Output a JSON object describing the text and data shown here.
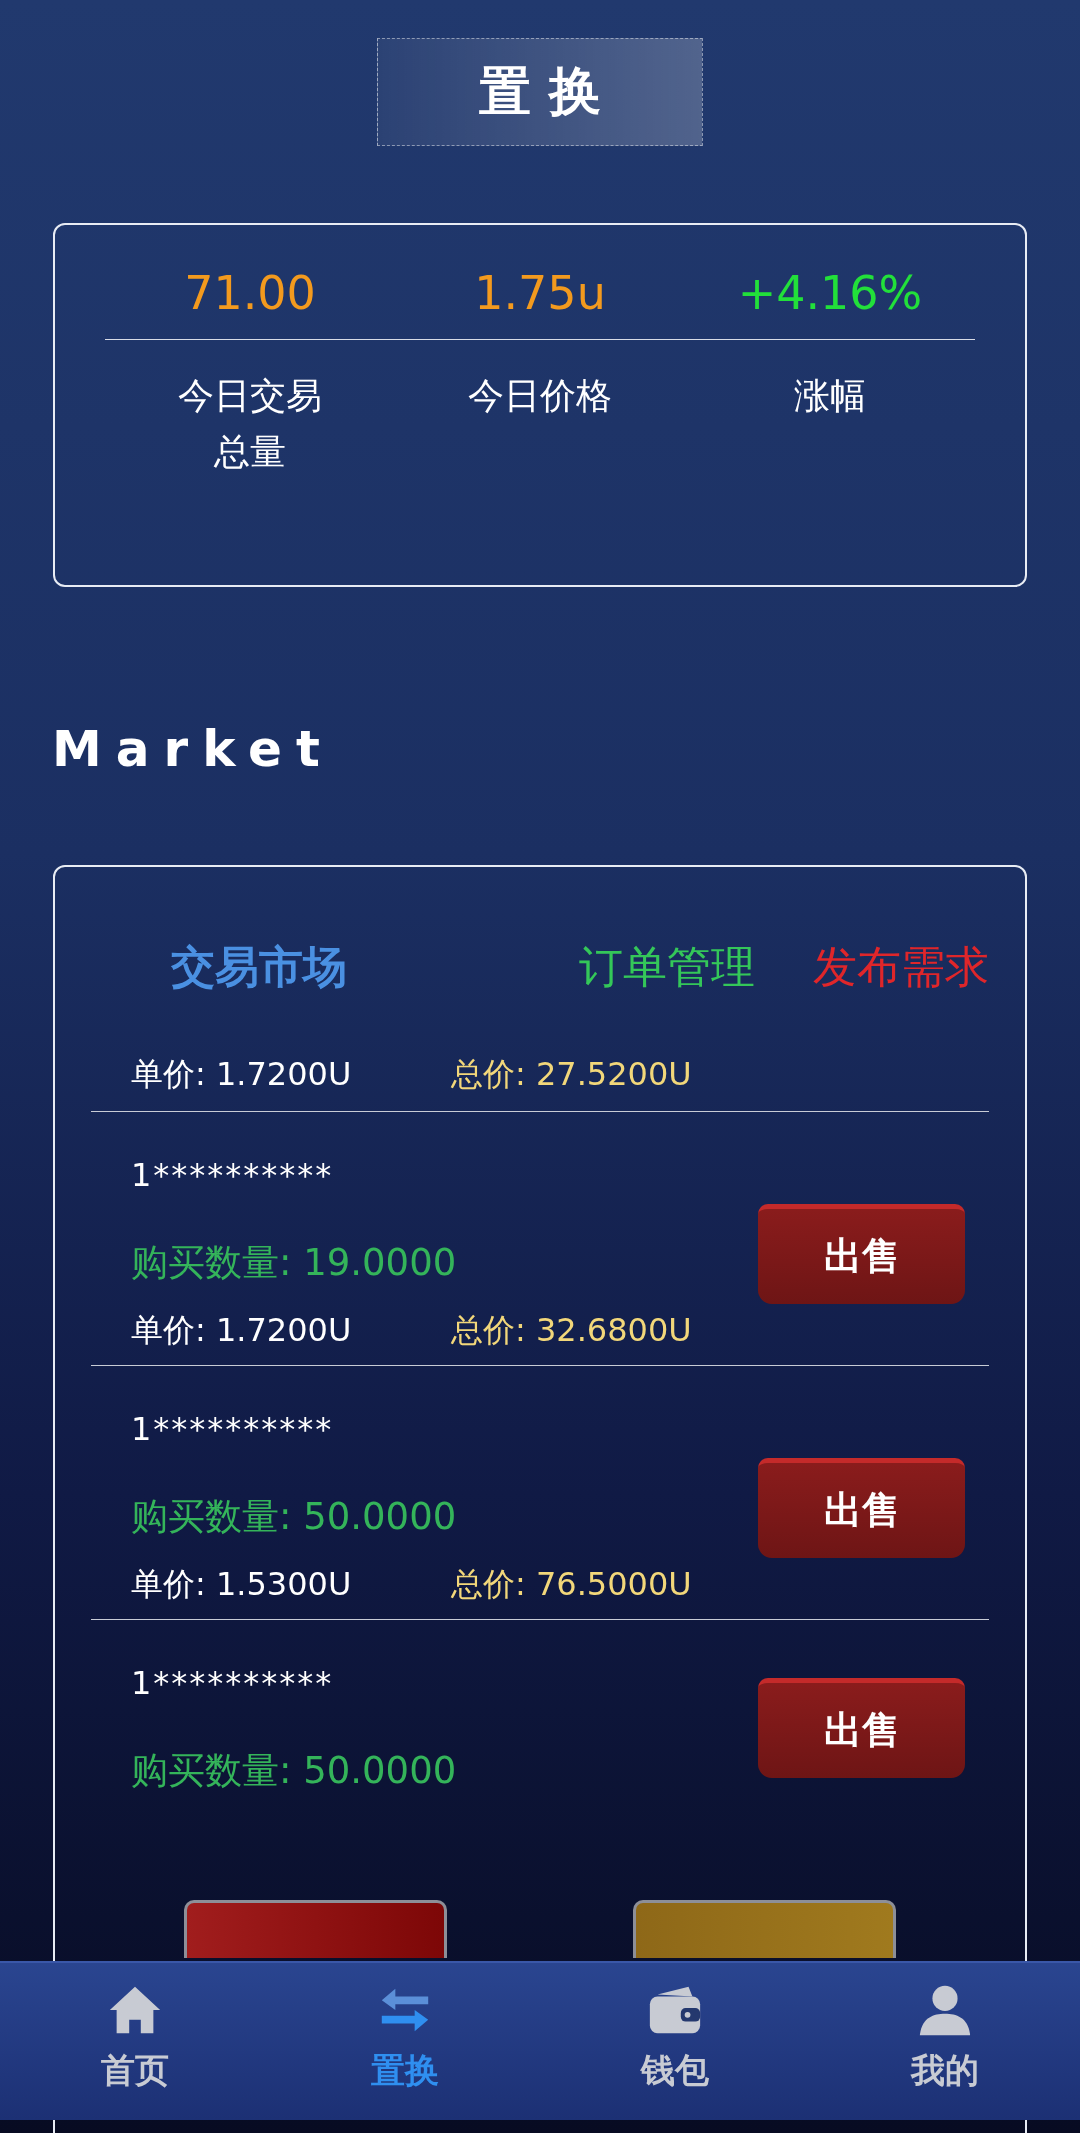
{
  "header": {
    "title": "置 换"
  },
  "stats": [
    {
      "value": "71.00",
      "label": "今日交易总量",
      "color": "#f39a1e"
    },
    {
      "value": "1.75u",
      "label": "今日价格",
      "color": "#f39a1e"
    },
    {
      "value": "+4.16%",
      "label": "涨幅",
      "color": "#22e03a"
    }
  ],
  "market": {
    "heading": "Market",
    "tabs": [
      {
        "label": "交易市场",
        "kind": "title"
      },
      {
        "label": "订单管理",
        "kind": "green"
      },
      {
        "label": "发布需求",
        "kind": "red"
      }
    ],
    "rows": [
      {
        "unit_price": "单价: 1.7200U",
        "total_price": "总价: 27.5200U"
      },
      {
        "user": "1**********",
        "quantity": "购买数量: 19.0000",
        "unit_price": "单价: 1.7200U",
        "total_price": "总价: 32.6800U",
        "action": "出售"
      },
      {
        "user": "1**********",
        "quantity": "购买数量: 50.0000",
        "unit_price": "单价: 1.5300U",
        "total_price": "总价: 76.5000U",
        "action": "出售"
      },
      {
        "user": "1**********",
        "quantity": "购买数量: 50.0000",
        "action": "出售"
      }
    ],
    "buttons": [
      {
        "kind": "red"
      },
      {
        "kind": "gold"
      }
    ]
  },
  "nav": [
    {
      "label": "首页",
      "selected": false
    },
    {
      "label": "置换",
      "selected": true
    },
    {
      "label": "钱包",
      "selected": false
    },
    {
      "label": "我的",
      "selected": false
    }
  ]
}
